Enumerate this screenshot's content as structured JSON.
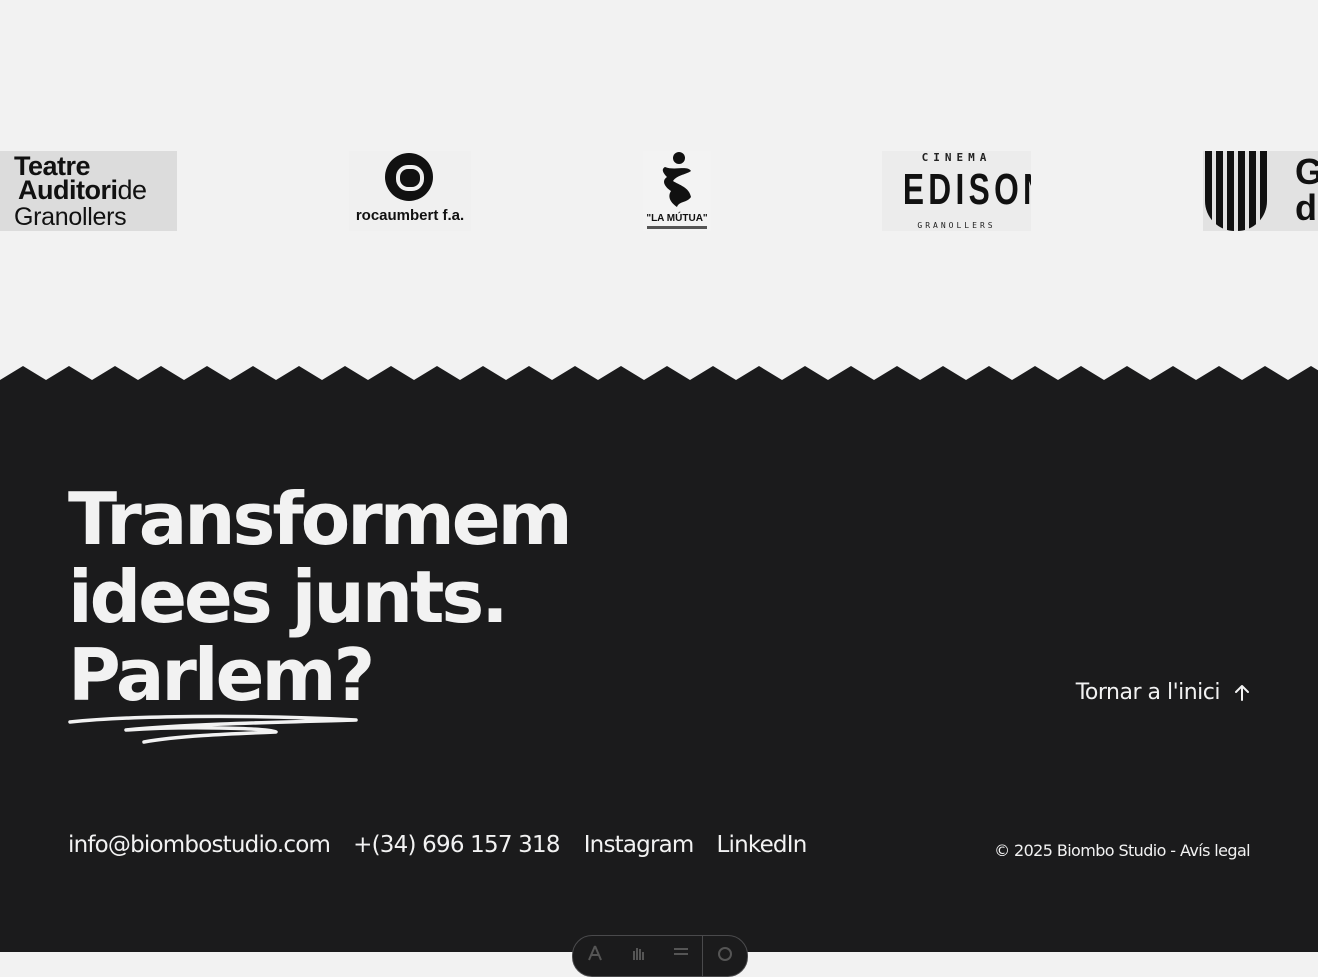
{
  "logos": {
    "teatre": {
      "line1": "Teatre",
      "line2_bold": "Auditori",
      "line2_light": "de",
      "line3": "Granollers"
    },
    "rocaumbert": {
      "text": "rocaumbert f.a."
    },
    "mutua": {
      "text": "\"LA MÚTUA\""
    },
    "edison": {
      "top": "CINEMA",
      "main": "EDISON",
      "bottom": "GRANOLLERS"
    },
    "generalitat": {
      "line1": "Ge",
      "line2": "de"
    }
  },
  "footer": {
    "headline": [
      "Transformem",
      "idees junts.",
      "Parlem?"
    ],
    "back_to_top": "Tornar a l'inici",
    "contacts": {
      "email": "info@biombostudio.com",
      "phone": "+(34) 696 157 318",
      "instagram": "Instagram",
      "linkedin": "LinkedIn"
    },
    "copyright": "© 2025 Biombo Studio - ",
    "legal": "Avís legal"
  },
  "colors": {
    "background_light": "#f2f2f2",
    "footer_background": "#1b1b1c",
    "footer_text": "#f2f2f2"
  },
  "icons": {
    "back_to_top": "arrow-up-icon",
    "toolbar": [
      "accessibility-icon",
      "hand-icon",
      "menu-icon",
      "settings-icon"
    ]
  }
}
